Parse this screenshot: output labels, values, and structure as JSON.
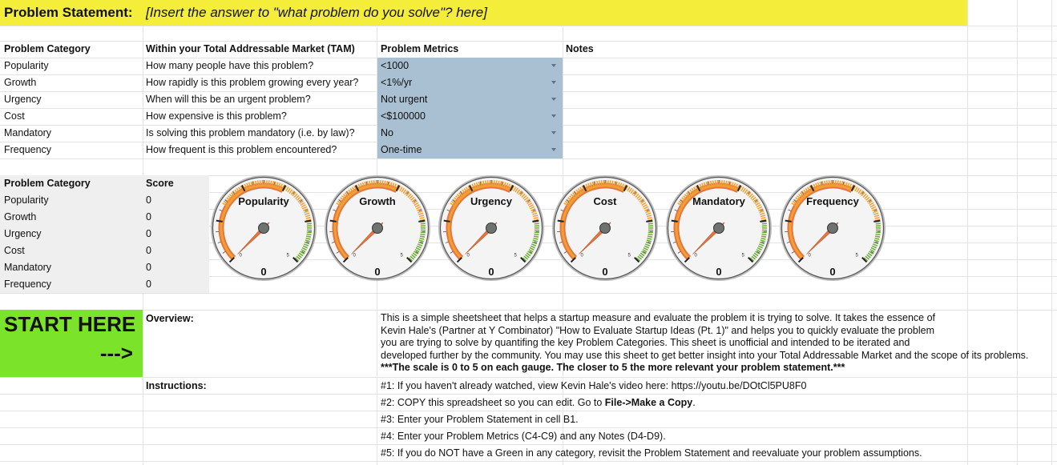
{
  "problem_statement": {
    "label": "Problem Statement:",
    "value": "[Insert the answer to \"what problem do you solve\"? here]"
  },
  "metrics_table": {
    "headers": [
      "Problem Category",
      "Within your Total Addressable Market (TAM)",
      "Problem Metrics",
      "Notes"
    ],
    "rows": [
      {
        "category": "Popularity",
        "question": "How many people have this problem?",
        "metric": "<1000"
      },
      {
        "category": "Growth",
        "question": "How rapidly is this problem growing every year?",
        "metric": "<1%/yr"
      },
      {
        "category": "Urgency",
        "question": "When will this be an urgent problem?",
        "metric": "Not urgent"
      },
      {
        "category": "Cost",
        "question": "How expensive is this problem?",
        "metric": "<$100000"
      },
      {
        "category": "Mandatory",
        "question": "Is solving this problem mandatory (i.e. by law)?",
        "metric": "No"
      },
      {
        "category": "Frequency",
        "question": "How frequent is this problem encountered?",
        "metric": "One-time"
      }
    ]
  },
  "score_table": {
    "headers": [
      "Problem Category",
      "Score"
    ],
    "rows": [
      {
        "category": "Popularity",
        "score": "0"
      },
      {
        "category": "Growth",
        "score": "0"
      },
      {
        "category": "Urgency",
        "score": "0"
      },
      {
        "category": "Cost",
        "score": "0"
      },
      {
        "category": "Mandatory",
        "score": "0"
      },
      {
        "category": "Frequency",
        "score": "0"
      }
    ]
  },
  "gauges": {
    "min_label": "0",
    "max_label": "5",
    "range": [
      0,
      5
    ],
    "colors": {
      "red": "#e7743f",
      "orange": "#f0a032",
      "green": "#6cab3a",
      "needle": "#e7743f"
    },
    "items": [
      {
        "title": "Popularity",
        "value": 0,
        "value_label": "0"
      },
      {
        "title": "Growth",
        "value": 0,
        "value_label": "0"
      },
      {
        "title": "Urgency",
        "value": 0,
        "value_label": "0"
      },
      {
        "title": "Cost",
        "value": 0,
        "value_label": "0"
      },
      {
        "title": "Mandatory",
        "value": 0,
        "value_label": "0"
      },
      {
        "title": "Frequency",
        "value": 0,
        "value_label": "0"
      }
    ]
  },
  "start_here": {
    "title": "START HERE",
    "arrow": "--->"
  },
  "overview": {
    "label": "Overview:",
    "lines": [
      "This is a simple sheetsheet that helps a startup measure and evaluate the problem it is trying to solve. It takes the essence of",
      "Kevin Hale's (Partner at Y Combinator) \"How to Evaluate Startup Ideas (Pt. 1)\" and helps you to quickly evaluate the problem",
      "you are trying to solve by quantifing the key Problem Categories. This sheet is unofficial and intended to be iterated and",
      "developed further by the community. You may use this sheet to get better insight into your Total Addressable Market and the scope of its problems."
    ],
    "bold_line": "***The scale is 0 to 5 on each gauge. The closer to 5 the more relevant your problem statement.***"
  },
  "instructions": {
    "label": "Instructions:",
    "steps": [
      {
        "text": "#1: If you haven't already watched, view Kevin Hale's video here: https://youtu.be/DOtCl5PU8F0"
      },
      {
        "text": "#2: COPY this spreadsheet so you can edit. Go to ",
        "bold": "File->Make a Copy",
        "after": "."
      },
      {
        "text": "#3: Enter your Problem Statement in cell B1."
      },
      {
        "text": "#4: Enter your Problem Metrics (C4-C9) and any Notes (D4-D9)."
      },
      {
        "text": "#5: If you do NOT have a Green in any category, revisit the Problem Statement and reevaluate your problem assumptions."
      }
    ]
  }
}
